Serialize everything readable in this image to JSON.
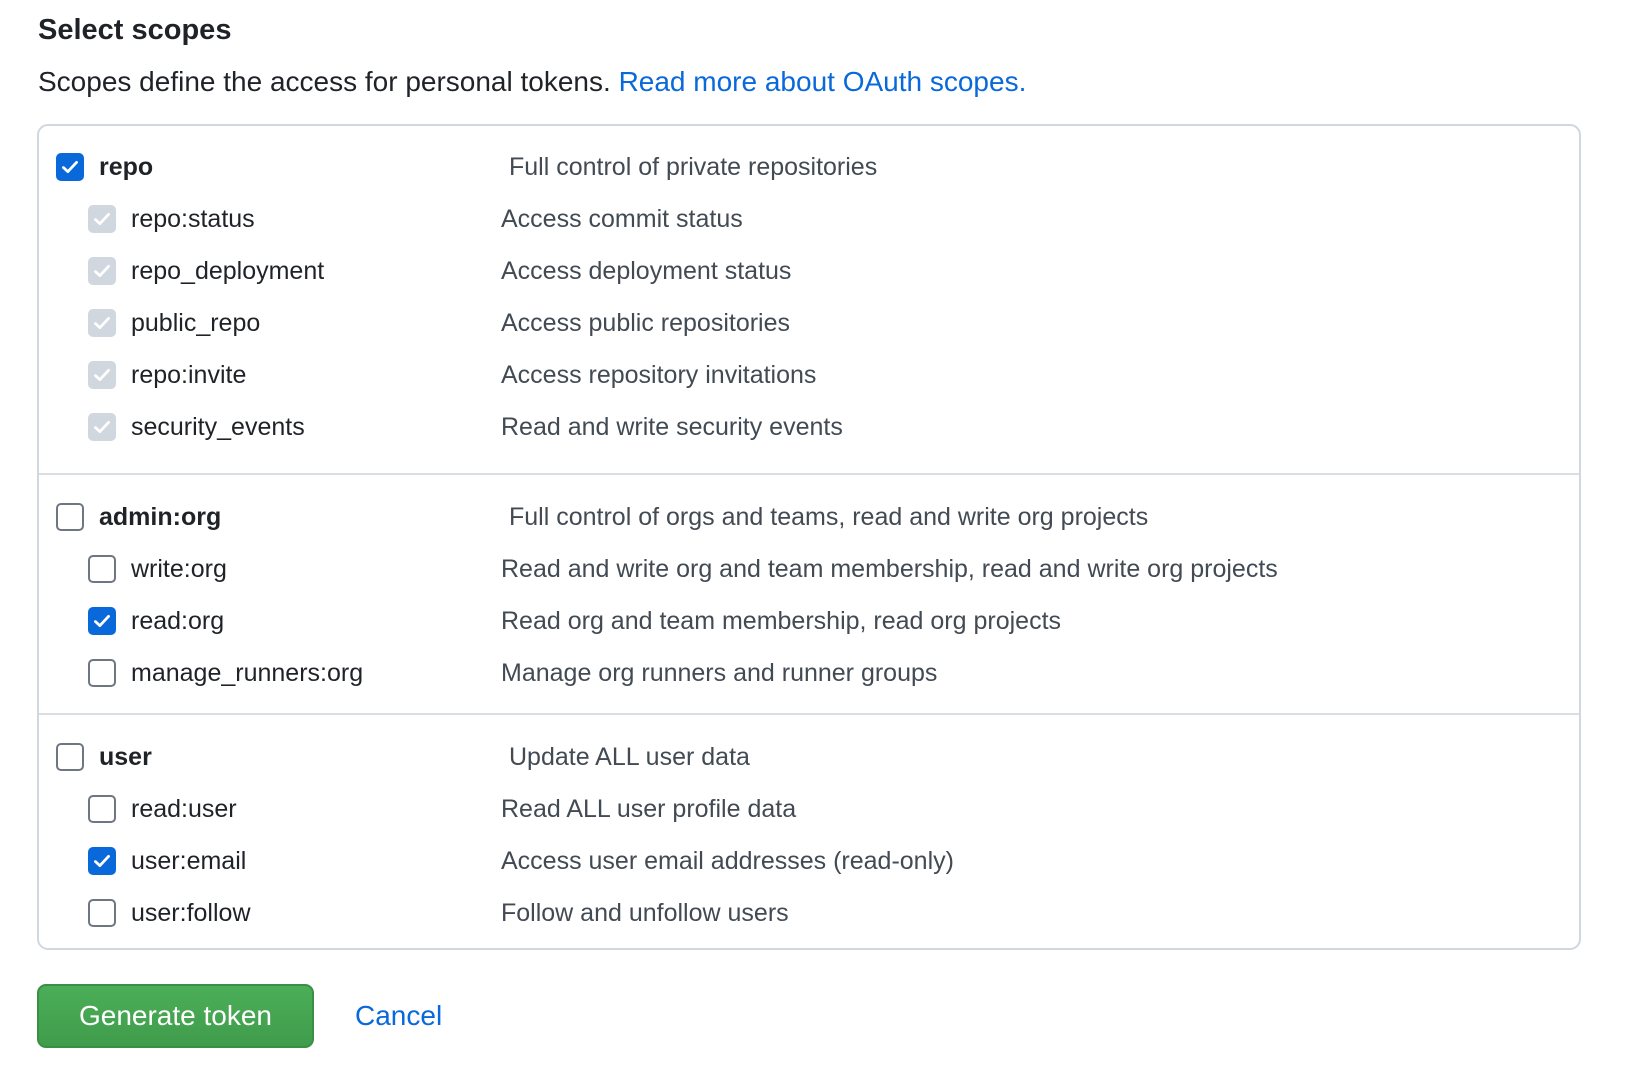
{
  "heading": "Select scopes",
  "intro": {
    "text": "Scopes define the access for personal tokens. ",
    "link_label": "Read more about OAuth scopes."
  },
  "groups": [
    {
      "name": "repo",
      "description": "Full control of private repositories",
      "state": "checked",
      "children": [
        {
          "name": "repo:status",
          "description": "Access commit status",
          "state": "disabled-checked"
        },
        {
          "name": "repo_deployment",
          "description": "Access deployment status",
          "state": "disabled-checked"
        },
        {
          "name": "public_repo",
          "description": "Access public repositories",
          "state": "disabled-checked"
        },
        {
          "name": "repo:invite",
          "description": "Access repository invitations",
          "state": "disabled-checked"
        },
        {
          "name": "security_events",
          "description": "Read and write security events",
          "state": "disabled-checked"
        }
      ]
    },
    {
      "name": "admin:org",
      "description": "Full control of orgs and teams, read and write org projects",
      "state": "unchecked",
      "children": [
        {
          "name": "write:org",
          "description": "Read and write org and team membership, read and write org projects",
          "state": "unchecked"
        },
        {
          "name": "read:org",
          "description": "Read org and team membership, read org projects",
          "state": "checked"
        },
        {
          "name": "manage_runners:org",
          "description": "Manage org runners and runner groups",
          "state": "unchecked"
        }
      ]
    },
    {
      "name": "user",
      "description": "Update ALL user data",
      "state": "unchecked",
      "children": [
        {
          "name": "read:user",
          "description": "Read ALL user profile data",
          "state": "unchecked"
        },
        {
          "name": "user:email",
          "description": "Access user email addresses (read-only)",
          "state": "checked"
        },
        {
          "name": "user:follow",
          "description": "Follow and unfollow users",
          "state": "unchecked"
        }
      ]
    }
  ],
  "actions": {
    "generate_label": "Generate token",
    "cancel_label": "Cancel"
  },
  "colors": {
    "accent": "#0969da",
    "primary_button": "#45a553",
    "disabled_check": "#d0d7de"
  },
  "icons": {
    "checkbox_checked": "check-icon"
  }
}
